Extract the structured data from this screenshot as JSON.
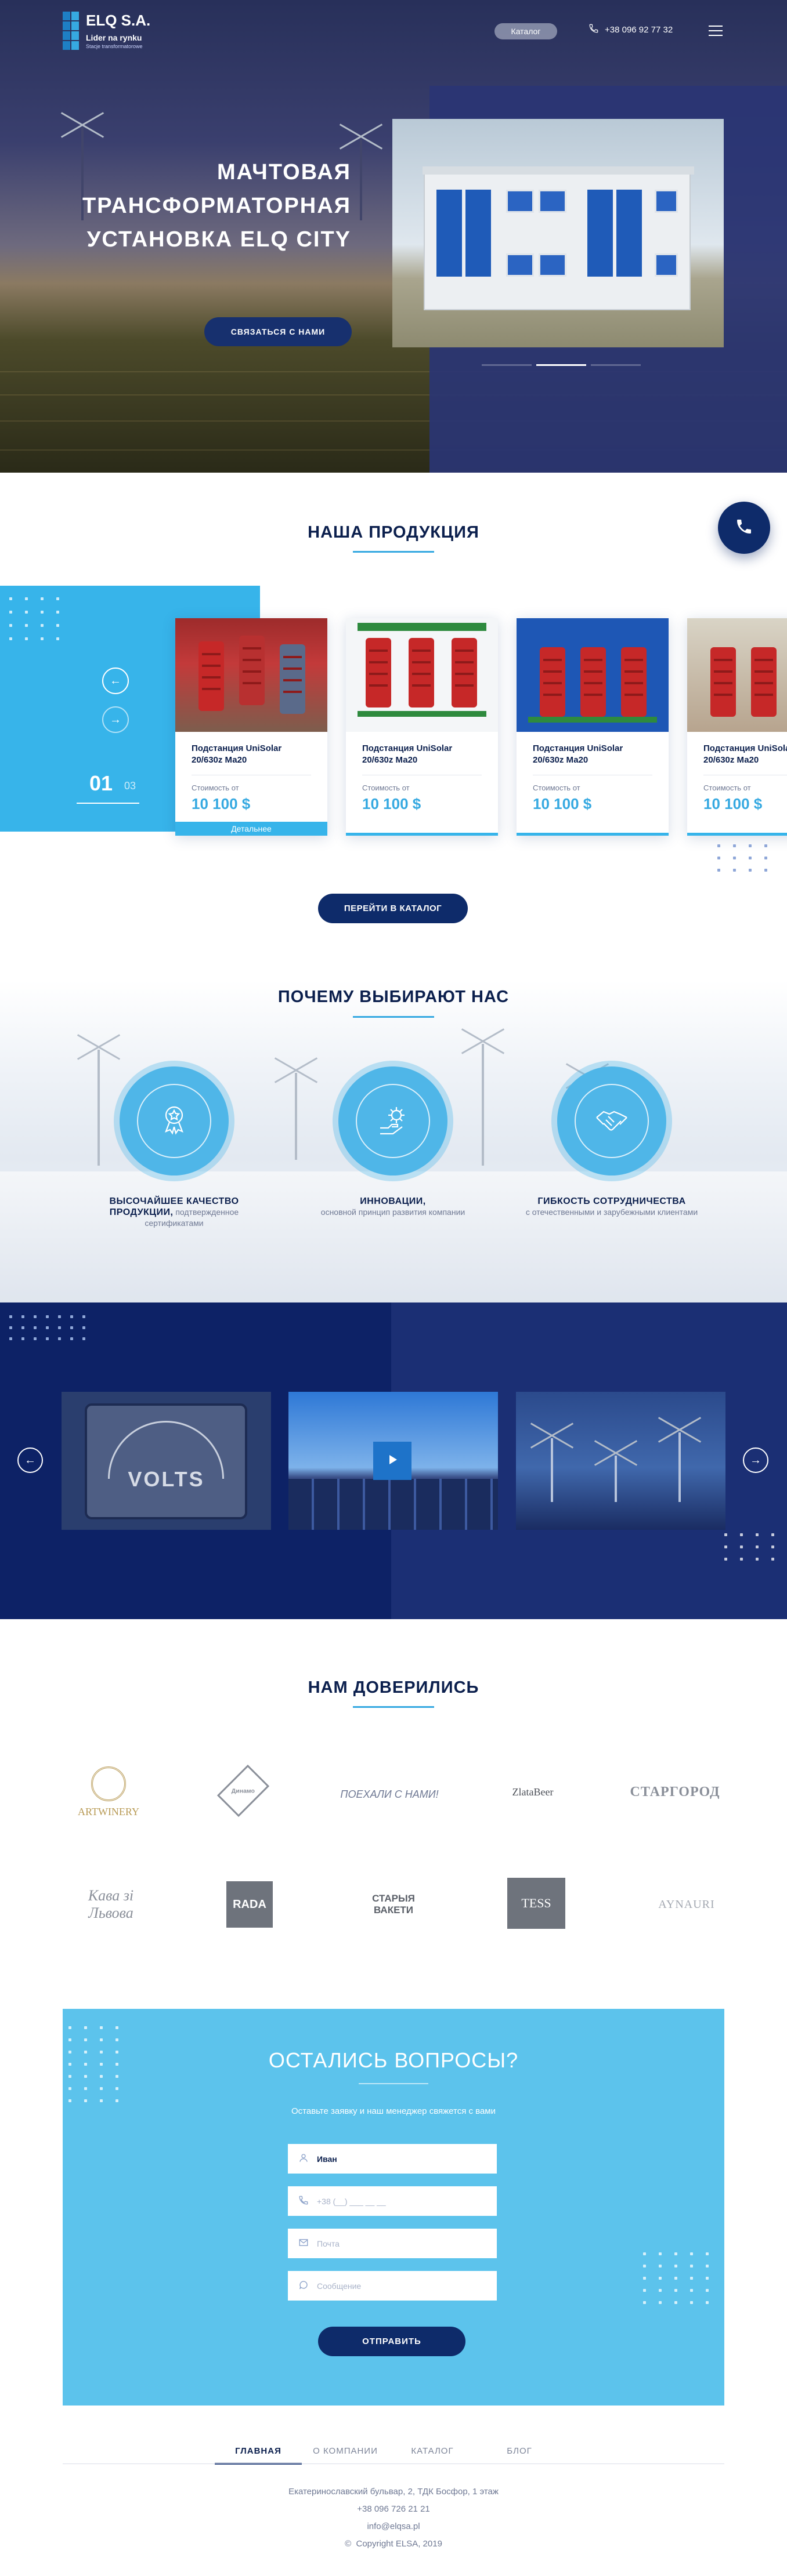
{
  "header": {
    "logo_name": "ELQ S.A.",
    "logo_tag": "Lider na rynku",
    "logo_sub": "Stacje transformatorowe",
    "catalog_label": "Каталог",
    "phone": "+38 096 92 77 32"
  },
  "hero": {
    "title_line1": "МАЧТОВАЯ",
    "title_line2": "ТРАНСФОРМАТОРНАЯ",
    "title_line3": "УСТАНОВКА ELQ CITY",
    "cta_label": "СВЯЗАТЬСЯ С НАМИ",
    "slides_total": 3,
    "slide_active": 2
  },
  "products": {
    "title": "НАША ПРОДУКЦИЯ",
    "slide_current": "01",
    "slide_total": "03",
    "items": [
      {
        "name": "Подстанция UniSolar 20/630z Ма20",
        "price_label": "Стоимость от",
        "price": "10 100 $",
        "details": "Детальнее"
      },
      {
        "name": "Подстанция UniSolar 20/630z Ма20",
        "price_label": "Стоимость от",
        "price": "10 100 $"
      },
      {
        "name": "Подстанция UniSolar 20/630z Ма20",
        "price_label": "Стоимость от",
        "price": "10 100 $"
      },
      {
        "name": "Подстанция UniSolar 20/630z Ма20",
        "price_label": "Стоимость от",
        "price": "10 100 $"
      }
    ],
    "catalog_button": "ПЕРЕЙТИ В КАТАЛОГ"
  },
  "why": {
    "title": "ПОЧЕМУ ВЫБИРАЮТ НАС",
    "items": [
      {
        "bold": "ВЫСОЧАЙШЕЕ КАЧЕСТВО ПРОДУКЦИИ,",
        "text": "подтвержденное сертификатами",
        "icon": "award-icon"
      },
      {
        "bold": "ИННОВАЦИИ,",
        "text": "основной принцип развития компании",
        "icon": "innovation-gear-icon"
      },
      {
        "bold": "ГИБКОСТЬ СОТРУДНИЧЕСТВА",
        "text": "с отечественными и зарубежными клиентами",
        "icon": "handshake-icon"
      }
    ]
  },
  "video": {
    "volts_label": "VOLTS"
  },
  "trusted": {
    "title": "НАМ ДОВЕРИЛИСЬ",
    "logos": [
      "ARTWINERY",
      "Динамо",
      "ПОЕХАЛИ С НАМИ!",
      "ZlataBeer",
      "СТАРГОРОД",
      "Кава зі Львова",
      "RADA",
      "СТАРЫЯ ВАКЕТИ",
      "TESS",
      "AYNAURI"
    ]
  },
  "form": {
    "title": "ОСТАЛИСЬ ВОПРОСЫ?",
    "subtitle": "Оставьте заявку и наш менеджер свяжется с вами",
    "name_value": "Иван",
    "phone_placeholder": "+38 (__) ___ __ __",
    "email_placeholder": "Почта",
    "message_placeholder": "Сообщение",
    "submit": "ОТПРАВИТЬ"
  },
  "footer": {
    "nav": [
      "ГЛАВНАЯ",
      "О КОМПАНИИ",
      "КАТАЛОГ",
      "БЛОГ"
    ],
    "address": "Екатеринославский бульвар, 2, ТДК Босфор, 1 этаж",
    "phone": "+38 096 726 21 21",
    "email": "info@elqsa.pl",
    "copyright": "Copyright ELSA, 2019"
  },
  "colors": {
    "navy": "#0e2b6a",
    "accent": "#36a9e1",
    "form_bg": "#5cc3ec"
  }
}
